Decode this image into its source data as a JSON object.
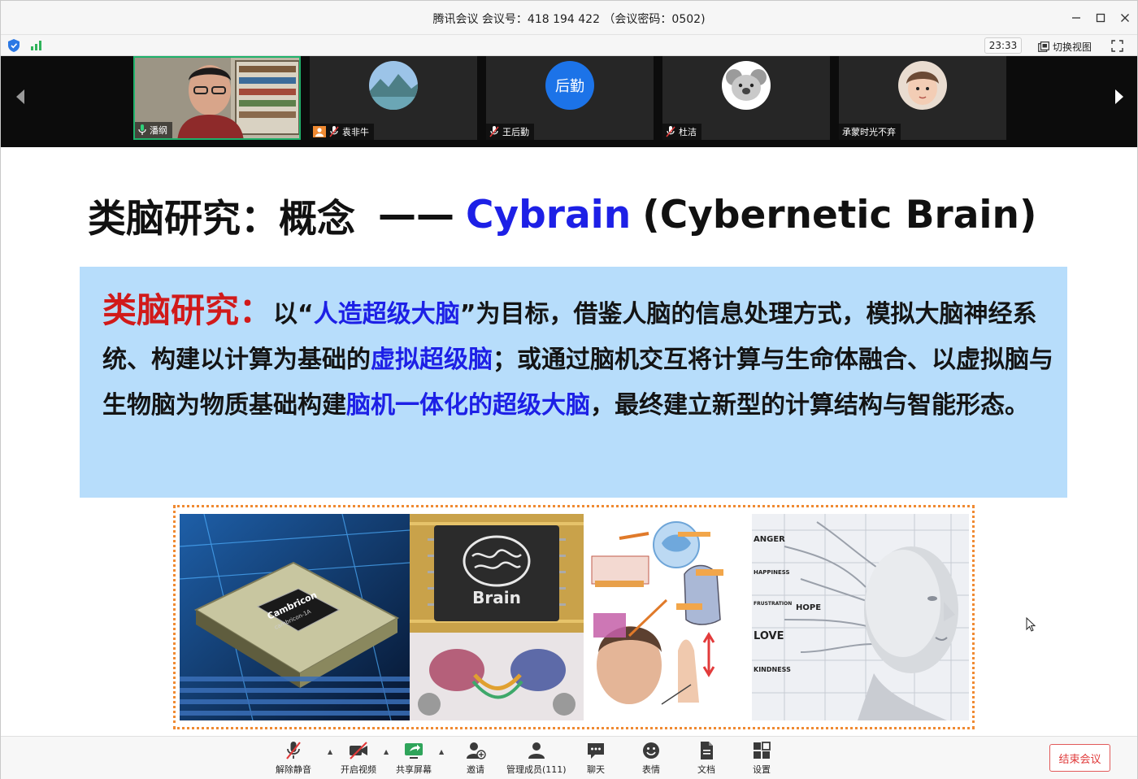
{
  "window": {
    "title": "腾讯会议 会议号：418 194 422 （会议密码：0502)"
  },
  "status": {
    "timer": "23:33",
    "switch_view_label": "切换视图"
  },
  "participants": [
    {
      "name": "潘纲",
      "mic": "on",
      "video": true
    },
    {
      "name": "袁非牛",
      "mic": "muted",
      "video": false,
      "avatar": "landscape"
    },
    {
      "name": "王后勤",
      "mic": "muted",
      "video": false,
      "avatar_text": "后勤",
      "avatar_color": "#1c73e8"
    },
    {
      "name": "杜洁",
      "mic": "muted",
      "video": false,
      "avatar": "koala"
    },
    {
      "name": "承蒙时光不弃",
      "mic": "none",
      "video": false,
      "avatar": "child-photo"
    }
  ],
  "slide": {
    "title_part1": "类脑研究：概念",
    "title_dash": "——",
    "title_part2": "Cybrain",
    "title_part3": "(Cybernetic Brain)",
    "def": {
      "label": "类脑研究：",
      "s1": "以“",
      "h1": "人造超级大脑",
      "s2": "”为目标，借鉴人脑的信息处理方式，模拟大脑神经系统、构建以计算为基础的",
      "h2": "虚拟超级脑",
      "s3": "；或通过脑机交互将计算与生命体融合、以虚拟脑与生物脑为物质基础构建",
      "h3": "脑机一体化的超级大脑",
      "s4": "，最终建立新型的计算结构与智能形态。"
    },
    "img_chip_brand": "Cambricon",
    "img_chip_model": "cambricon-1A",
    "img_brain_chip_label": "Brain",
    "img_face_words": [
      "ANGER",
      "HAPPINESS",
      "FRUSTRATION",
      "HOPE",
      "LOVE",
      "KINDNESS"
    ]
  },
  "toolbar": {
    "items": [
      {
        "label": "解除静音",
        "icon": "mic-muted-icon",
        "caret": true
      },
      {
        "label": "开启视频",
        "icon": "video-off-icon",
        "caret": true
      },
      {
        "label": "共享屏幕",
        "icon": "share-screen-icon",
        "caret": true
      },
      {
        "label": "邀请",
        "icon": "invite-icon"
      },
      {
        "label": "管理成员(111)",
        "icon": "members-icon"
      },
      {
        "label": "聊天",
        "icon": "chat-icon"
      },
      {
        "label": "表情",
        "icon": "emoji-icon"
      },
      {
        "label": "文档",
        "icon": "document-icon"
      },
      {
        "label": "设置",
        "icon": "settings-icon"
      }
    ],
    "end_label": "结束会议"
  },
  "colors": {
    "accent_blue": "#1d20e6",
    "accent_red": "#d11a1a",
    "box_bg": "#b7ddfb",
    "end_red": "#e03a3a",
    "active_green": "#1fb26b"
  }
}
